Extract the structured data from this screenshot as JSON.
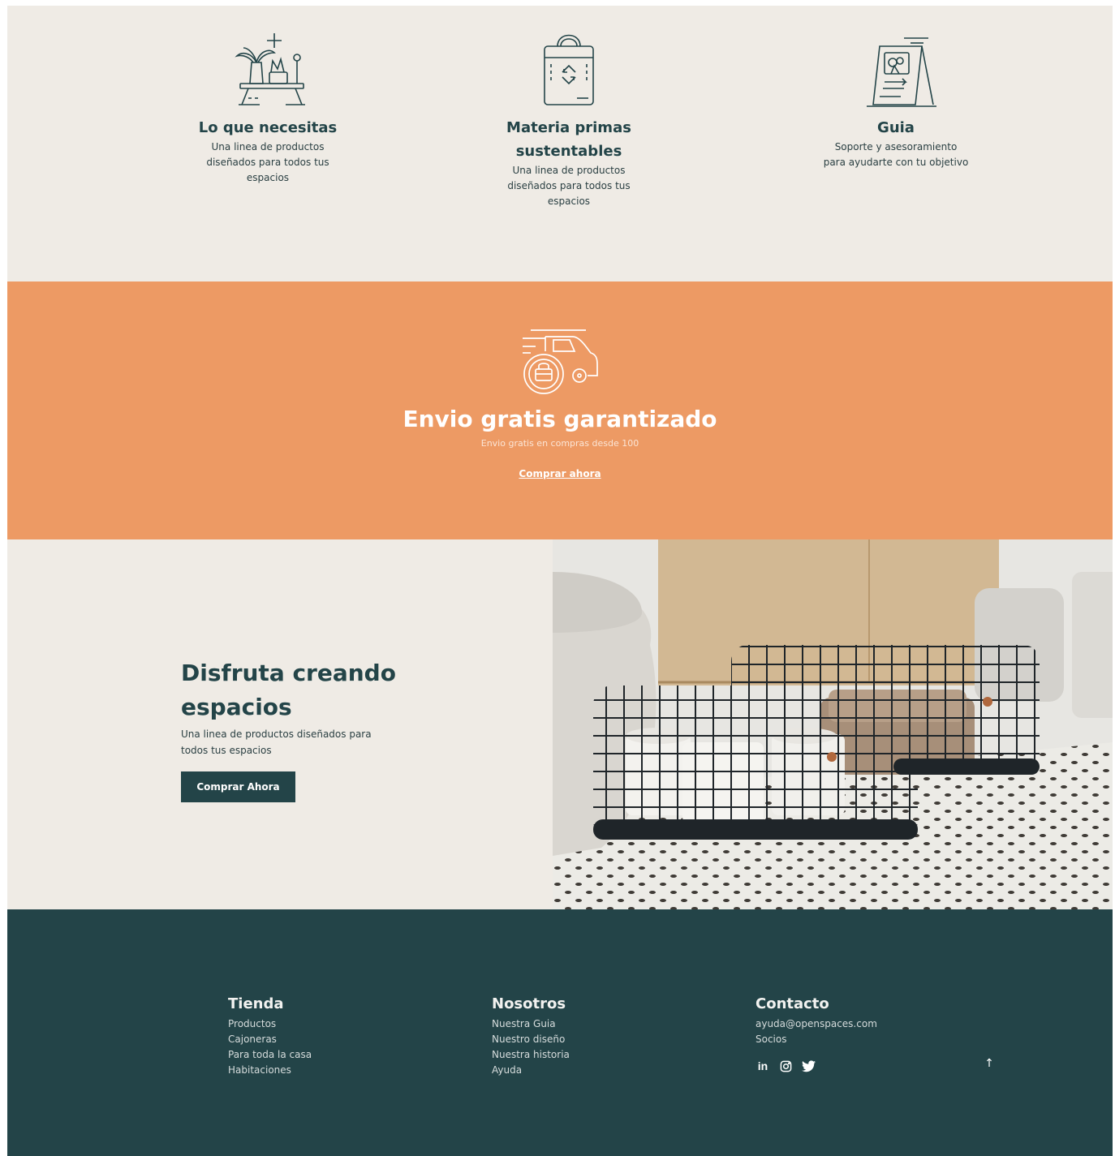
{
  "features": [
    {
      "icon": "plant-shelf-icon",
      "title": "Lo que necesitas",
      "description": "Una linea de productos diseñados para todos tus espacios"
    },
    {
      "icon": "recycle-bag-icon",
      "title": "Materia primas sustentables",
      "description": "Una linea de productos diseñados para todos tus espacios"
    },
    {
      "icon": "guide-board-icon",
      "title": "Guia",
      "description": "Soporte y asesoramiento para ayudarte con tu objetivo"
    }
  ],
  "banner": {
    "icon": "delivery-van-icon",
    "title": "Envio gratis garantizado",
    "subtitle": "Envio gratis en compras desde 100",
    "link": "Comprar ahora",
    "background": "#ed9a64"
  },
  "promo": {
    "title": "Disfruta creando espacios",
    "description": "Una linea de productos diseñados para todos tus espacios",
    "button": "Comprar Ahora",
    "image": "bathroom-wire-baskets-photo"
  },
  "footer": {
    "background": "#234448",
    "columns": [
      {
        "title": "Tienda",
        "links": [
          "Productos",
          "Cajoneras",
          "Para toda la casa",
          "Habitaciones"
        ]
      },
      {
        "title": "Nosotros",
        "links": [
          "Nuestra Guia",
          "Nuestro diseño",
          "Nuestra historia",
          "Ayuda"
        ]
      },
      {
        "title": "Contacto",
        "links": [
          "ayuda@openspaces.com",
          "Socios"
        ]
      }
    ],
    "social": {
      "linkedin": "in",
      "instagram": "instagram-icon",
      "twitter": "twitter-icon"
    },
    "back_to_top": "↑"
  },
  "colors": {
    "primary": "#234448",
    "accent": "#ed9a64",
    "beige": "#efebe5"
  }
}
